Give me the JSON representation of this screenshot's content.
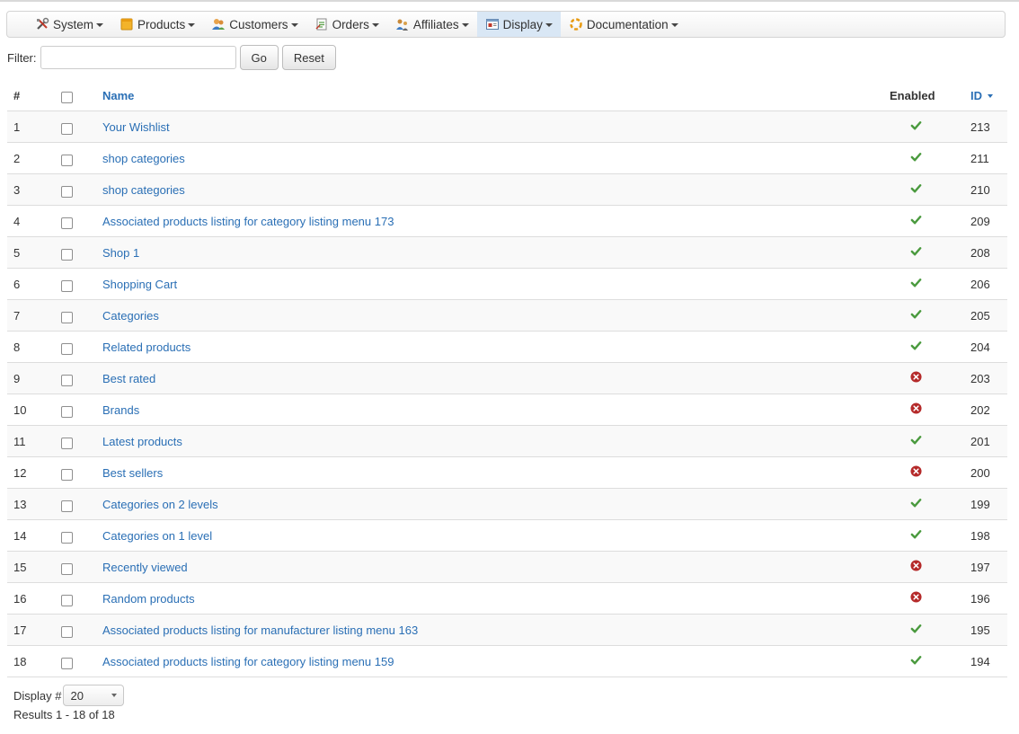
{
  "menu": [
    {
      "label": "System",
      "icon": "tools-icon",
      "active": false
    },
    {
      "label": "Products",
      "icon": "box-icon",
      "active": false
    },
    {
      "label": "Customers",
      "icon": "users-icon",
      "active": false
    },
    {
      "label": "Orders",
      "icon": "order-icon",
      "active": false
    },
    {
      "label": "Affiliates",
      "icon": "affiliates-icon",
      "active": false
    },
    {
      "label": "Display",
      "icon": "display-icon",
      "active": true
    },
    {
      "label": "Documentation",
      "icon": "help-icon",
      "active": false
    }
  ],
  "filter": {
    "label": "Filter:",
    "value": "",
    "go_label": "Go",
    "reset_label": "Reset"
  },
  "table": {
    "headers": {
      "num": "#",
      "name": "Name",
      "enabled": "Enabled",
      "id": "ID"
    },
    "rows": [
      {
        "num": "1",
        "name": "Your Wishlist",
        "enabled": true,
        "id": "213"
      },
      {
        "num": "2",
        "name": "shop categories",
        "enabled": true,
        "id": "211"
      },
      {
        "num": "3",
        "name": "shop categories",
        "enabled": true,
        "id": "210"
      },
      {
        "num": "4",
        "name": "Associated products listing for category listing menu 173",
        "enabled": true,
        "id": "209"
      },
      {
        "num": "5",
        "name": "Shop 1",
        "enabled": true,
        "id": "208"
      },
      {
        "num": "6",
        "name": "Shopping Cart",
        "enabled": true,
        "id": "206"
      },
      {
        "num": "7",
        "name": "Categories",
        "enabled": true,
        "id": "205"
      },
      {
        "num": "8",
        "name": "Related products",
        "enabled": true,
        "id": "204"
      },
      {
        "num": "9",
        "name": "Best rated",
        "enabled": false,
        "id": "203"
      },
      {
        "num": "10",
        "name": "Brands",
        "enabled": false,
        "id": "202"
      },
      {
        "num": "11",
        "name": "Latest products",
        "enabled": true,
        "id": "201"
      },
      {
        "num": "12",
        "name": "Best sellers",
        "enabled": false,
        "id": "200"
      },
      {
        "num": "13",
        "name": "Categories on 2 levels",
        "enabled": true,
        "id": "199"
      },
      {
        "num": "14",
        "name": "Categories on 1 level",
        "enabled": true,
        "id": "198"
      },
      {
        "num": "15",
        "name": "Recently viewed",
        "enabled": false,
        "id": "197"
      },
      {
        "num": "16",
        "name": "Random products",
        "enabled": false,
        "id": "196"
      },
      {
        "num": "17",
        "name": "Associated products listing for manufacturer listing menu 163",
        "enabled": true,
        "id": "195"
      },
      {
        "num": "18",
        "name": "Associated products listing for category listing menu 159",
        "enabled": true,
        "id": "194"
      }
    ]
  },
  "footer": {
    "display_label": "Display #",
    "display_value": "20",
    "results": "Results 1 - 18 of 18"
  },
  "colors": {
    "link": "#2a6fb5",
    "enabled": "#4a9a3e",
    "disabled": "#b52a2a",
    "active_menu": "#d9e7f5"
  }
}
